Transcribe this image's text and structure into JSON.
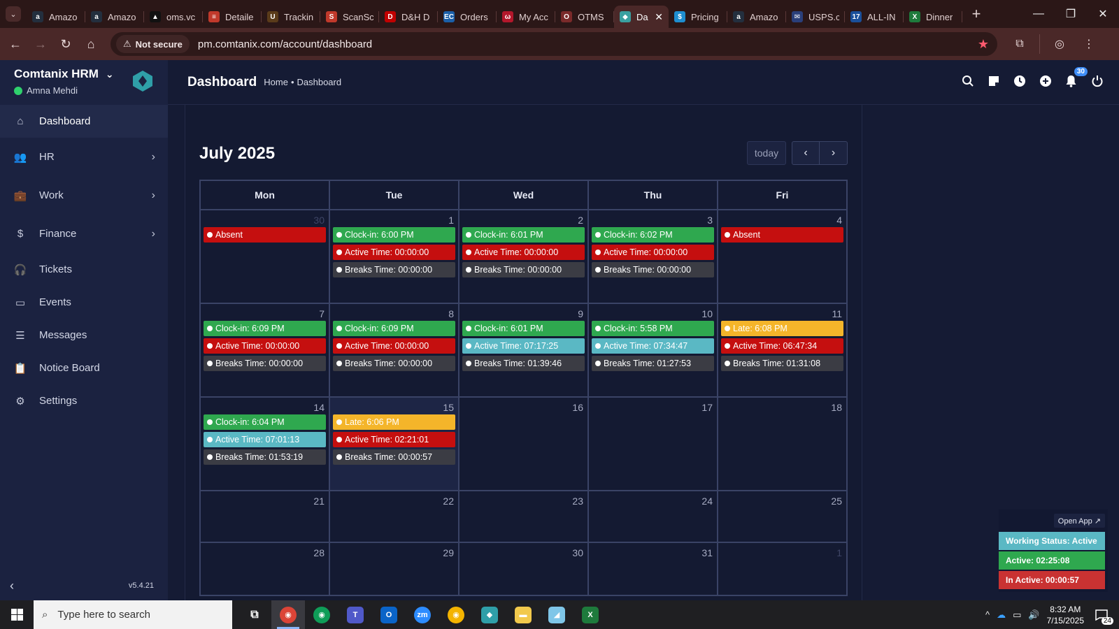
{
  "browser": {
    "tabs": [
      {
        "label": "Amazo",
        "fav": "a",
        "color": "#232f3e"
      },
      {
        "label": "Amazo",
        "fav": "a",
        "color": "#232f3e"
      },
      {
        "label": "oms.vc",
        "fav": "▲",
        "color": "#111111"
      },
      {
        "label": "Detaile",
        "fav": "≡",
        "color": "#c0392b"
      },
      {
        "label": "Trackin",
        "fav": "U",
        "color": "#5a3b1a"
      },
      {
        "label": "ScanSc",
        "fav": "S",
        "color": "#c0392b"
      },
      {
        "label": "D&H D",
        "fav": "D",
        "color": "#c00000"
      },
      {
        "label": "Orders",
        "fav": "EC",
        "color": "#1b5fa8"
      },
      {
        "label": "My Acc",
        "fav": "ω",
        "color": "#b3172b"
      },
      {
        "label": "OTMS",
        "fav": "O",
        "color": "#7a2a2a"
      },
      {
        "label": "Da",
        "fav": "◆",
        "color": "#3aa0a0",
        "active": true
      },
      {
        "label": "Pricing",
        "fav": "$",
        "color": "#1e8ed0"
      },
      {
        "label": "Amazo",
        "fav": "a",
        "color": "#232f3e"
      },
      {
        "label": "USPS.c",
        "fav": "✉",
        "color": "#2a3f7a"
      },
      {
        "label": "ALL-IN",
        "fav": "17",
        "color": "#1a4f9a"
      },
      {
        "label": "Dinner",
        "fav": "X",
        "color": "#1e7a3c"
      }
    ],
    "not_secure": "Not secure",
    "url": "pm.comtanix.com/account/dashboard"
  },
  "sidebar": {
    "brand": "Comtanix HRM",
    "user": "Amna Mehdi",
    "items": [
      {
        "label": "Dashboard",
        "icon": "home-icon",
        "glyph": "⌂",
        "active": true,
        "chevron": false
      },
      {
        "label": "HR",
        "icon": "users-icon",
        "glyph": "👥",
        "chevron": true
      },
      {
        "label": "Work",
        "icon": "briefcase-icon",
        "glyph": "💼",
        "chevron": true
      },
      {
        "label": "Finance",
        "icon": "dollar-icon",
        "glyph": "$",
        "chevron": true
      },
      {
        "label": "Tickets",
        "icon": "headset-icon",
        "glyph": "🎧",
        "chevron": false
      },
      {
        "label": "Events",
        "icon": "calendar-icon",
        "glyph": "▭",
        "chevron": false
      },
      {
        "label": "Messages",
        "icon": "message-icon",
        "glyph": "☰",
        "chevron": false
      },
      {
        "label": "Notice Board",
        "icon": "clipboard-icon",
        "glyph": "📋",
        "chevron": false
      },
      {
        "label": "Settings",
        "icon": "gear-icon",
        "glyph": "⚙",
        "chevron": false
      }
    ],
    "version": "v5.4.21"
  },
  "header": {
    "title": "Dashboard",
    "crumb_home": "Home",
    "crumb_sep": "•",
    "crumb_current": "Dashboard",
    "notification_count": "30"
  },
  "calendar": {
    "title": "July 2025",
    "today_label": "today",
    "weekdays": [
      "Mon",
      "Tue",
      "Wed",
      "Thu",
      "Fri"
    ],
    "weeks": [
      {
        "days": [
          {
            "num": "30",
            "other": true,
            "events": [
              {
                "text": "Absent",
                "color": "red"
              }
            ]
          },
          {
            "num": "1",
            "events": [
              {
                "text": "Clock-in: 6:00 PM",
                "color": "green"
              },
              {
                "text": "Active Time: 00:00:00",
                "color": "red"
              },
              {
                "text": "Breaks Time: 00:00:00",
                "color": "grey"
              }
            ]
          },
          {
            "num": "2",
            "events": [
              {
                "text": "Clock-in: 6:01 PM",
                "color": "green"
              },
              {
                "text": "Active Time: 00:00:00",
                "color": "red"
              },
              {
                "text": "Breaks Time: 00:00:00",
                "color": "grey"
              }
            ]
          },
          {
            "num": "3",
            "events": [
              {
                "text": "Clock-in: 6:02 PM",
                "color": "green"
              },
              {
                "text": "Active Time: 00:00:00",
                "color": "red"
              },
              {
                "text": "Breaks Time: 00:00:00",
                "color": "grey"
              }
            ]
          },
          {
            "num": "4",
            "events": [
              {
                "text": "Absent",
                "color": "red"
              }
            ]
          }
        ]
      },
      {
        "days": [
          {
            "num": "7",
            "events": [
              {
                "text": "Clock-in: 6:09 PM",
                "color": "green"
              },
              {
                "text": "Active Time: 00:00:00",
                "color": "red"
              },
              {
                "text": "Breaks Time: 00:00:00",
                "color": "grey"
              }
            ]
          },
          {
            "num": "8",
            "events": [
              {
                "text": "Clock-in: 6:09 PM",
                "color": "green"
              },
              {
                "text": "Active Time: 00:00:00",
                "color": "red"
              },
              {
                "text": "Breaks Time: 00:00:00",
                "color": "grey"
              }
            ]
          },
          {
            "num": "9",
            "events": [
              {
                "text": "Clock-in: 6:01 PM",
                "color": "green"
              },
              {
                "text": "Active Time: 07:17:25",
                "color": "cyan"
              },
              {
                "text": "Breaks Time: 01:39:46",
                "color": "grey"
              }
            ]
          },
          {
            "num": "10",
            "events": [
              {
                "text": "Clock-in: 5:58 PM",
                "color": "green"
              },
              {
                "text": "Active Time: 07:34:47",
                "color": "cyan"
              },
              {
                "text": "Breaks Time: 01:27:53",
                "color": "grey"
              }
            ]
          },
          {
            "num": "11",
            "events": [
              {
                "text": "Late: 6:08 PM",
                "color": "yellow"
              },
              {
                "text": "Active Time: 06:47:34",
                "color": "red"
              },
              {
                "text": "Breaks Time: 01:31:08",
                "color": "grey"
              }
            ]
          }
        ]
      },
      {
        "days": [
          {
            "num": "14",
            "events": [
              {
                "text": "Clock-in: 6:04 PM",
                "color": "green"
              },
              {
                "text": "Active Time: 07:01:13",
                "color": "cyan"
              },
              {
                "text": "Breaks Time: 01:53:19",
                "color": "grey"
              }
            ]
          },
          {
            "num": "15",
            "today": true,
            "events": [
              {
                "text": "Late: 6:06 PM",
                "color": "yellow"
              },
              {
                "text": "Active Time: 02:21:01",
                "color": "red"
              },
              {
                "text": "Breaks Time: 00:00:57",
                "color": "grey"
              }
            ]
          },
          {
            "num": "16",
            "events": []
          },
          {
            "num": "17",
            "events": []
          },
          {
            "num": "18",
            "events": []
          }
        ]
      },
      {
        "days": [
          {
            "num": "21",
            "events": []
          },
          {
            "num": "22",
            "events": []
          },
          {
            "num": "23",
            "events": []
          },
          {
            "num": "24",
            "events": []
          },
          {
            "num": "25",
            "events": []
          }
        ]
      },
      {
        "days": [
          {
            "num": "28",
            "events": []
          },
          {
            "num": "29",
            "events": []
          },
          {
            "num": "30",
            "events": []
          },
          {
            "num": "31",
            "events": []
          },
          {
            "num": "1",
            "other": true,
            "events": []
          }
        ]
      }
    ]
  },
  "status_widget": {
    "open_app": "Open App ↗",
    "working_status": "Working Status: Active",
    "active": "Active: 02:25:08",
    "inactive": "In Active: 00:00:57"
  },
  "taskbar": {
    "search_placeholder": "Type here to search",
    "time": "8:32 AM",
    "date": "7/15/2025",
    "notif_count": "24"
  },
  "colors": {
    "green": "#2fa84f",
    "red": "#c50f0f",
    "grey": "#3b3c44",
    "cyan": "#5ab8c4",
    "yellow": "#f4b52a"
  }
}
